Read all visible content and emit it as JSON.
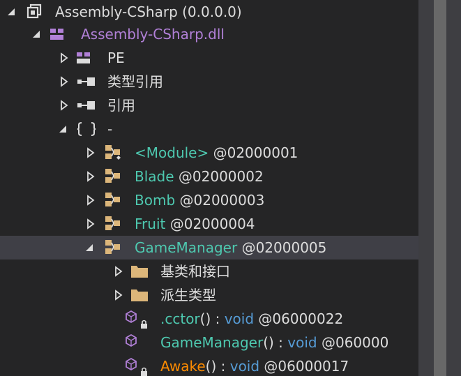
{
  "assembly": {
    "label": "Assembly-CSharp (0.0.0.0)",
    "module_label": "Assembly-CSharp.dll"
  },
  "module_children": [
    {
      "label": "PE"
    },
    {
      "label": "类型引用"
    },
    {
      "label": "引用"
    },
    {
      "label": "-"
    }
  ],
  "types": [
    {
      "name": "<Module>",
      "token": "@02000001"
    },
    {
      "name": "Blade",
      "token": "@02000002"
    },
    {
      "name": "Bomb",
      "token": "@02000003"
    },
    {
      "name": "Fruit",
      "token": "@02000004"
    },
    {
      "name": "GameManager",
      "token": "@02000005"
    }
  ],
  "gamemanager_children": [
    {
      "label": "基类和接口"
    },
    {
      "label": "派生类型"
    }
  ],
  "members": [
    {
      "name": ".cctor",
      "sig": "() : ",
      "ret": "void",
      "token": " @06000022"
    },
    {
      "name": "GameManager",
      "sig": "() : ",
      "ret": "void",
      "token": " @060000"
    },
    {
      "name": "Awake",
      "sig": "() : ",
      "ret": "void",
      "token": " @06000017"
    }
  ],
  "colors": {
    "background": "#252526",
    "selected_row": "#3f3f46",
    "assembly_purple": "#b180d7",
    "type_teal": "#4ec9b0",
    "keyword_blue": "#569cd6",
    "method_orange": "#ff8c00",
    "folder_tan": "#dcb67a"
  },
  "icons": {
    "assembly": "assembly-icon",
    "module": "module-icon",
    "pe": "pe-icon",
    "reference": "reference-icon",
    "namespace": "namespace-icon",
    "class": "class-icon",
    "folder": "folder-icon",
    "method": "method-icon"
  }
}
